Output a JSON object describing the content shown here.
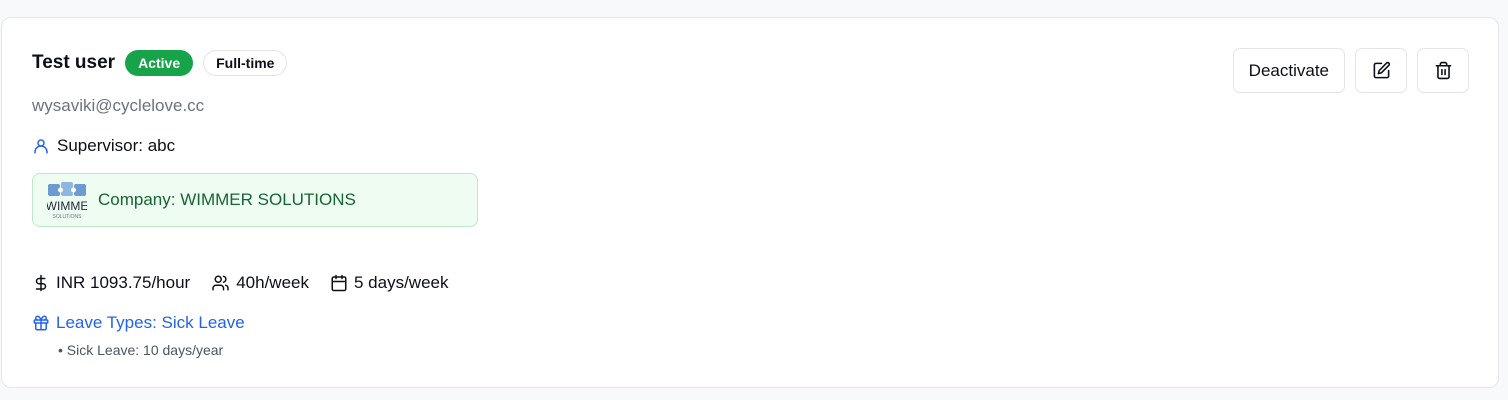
{
  "employee": {
    "name": "Test user",
    "status_badge": "Active",
    "employment_type": "Full-time",
    "email": "wysaviki@cyclelove.cc",
    "supervisor": "Supervisor: abc",
    "company": "Company: WIMMER SOLUTIONS",
    "rate": "INR 1093.75/hour",
    "hours": "40h/week",
    "days": "5 days/week",
    "leave_types": "Leave Types: Sick Leave",
    "leave_detail": "• Sick Leave: 10 days/year"
  },
  "actions": {
    "deactivate_label": "Deactivate"
  },
  "logo": {
    "text": "WIMME",
    "subtext": "SOLUTIONS"
  },
  "icons": {
    "supervisor": "user-icon",
    "rate": "dollar-icon",
    "hours": "users-icon",
    "days": "calendar-icon",
    "leave": "gift-icon",
    "edit": "edit-icon",
    "delete": "trash-icon"
  },
  "colors": {
    "active_badge": "#16a34a",
    "company_bg": "#effcf2",
    "company_text": "#166534",
    "link_blue": "#2563eb",
    "muted_text": "#6b7280"
  }
}
